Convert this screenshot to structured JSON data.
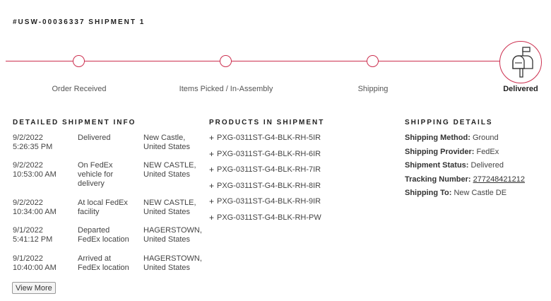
{
  "shipment": {
    "title": "#USW-00036337 SHIPMENT 1"
  },
  "tracker": {
    "accent_color": "#cc2f4f",
    "steps": [
      {
        "label": "Order Received"
      },
      {
        "label": "Items Picked / In-Assembly"
      },
      {
        "label": "Shipping"
      },
      {
        "label": "Delivered",
        "icon": "mailbox-icon",
        "active": true
      }
    ]
  },
  "detailed_info": {
    "heading": "DETAILED SHIPMENT INFO",
    "events": [
      {
        "date": "9/2/2022",
        "time": "5:26:35 PM",
        "status": "Delivered",
        "location_1": "New Castle,",
        "location_2": "United States"
      },
      {
        "date": "9/2/2022",
        "time": "10:53:00 AM",
        "status_1": "On FedEx",
        "status_2": "vehicle for",
        "status_3": "delivery",
        "location_1": "NEW CASTLE,",
        "location_2": "United States"
      },
      {
        "date": "9/2/2022",
        "time": "10:34:00 AM",
        "status_1": "At local FedEx",
        "status_2": "facility",
        "location_1": "NEW CASTLE,",
        "location_2": "United States"
      },
      {
        "date": "9/1/2022",
        "time": "5:41:12 PM",
        "status_1": "Departed",
        "status_2": "FedEx location",
        "location_1": "HAGERSTOWN,",
        "location_2": "United States"
      },
      {
        "date": "9/1/2022",
        "time": "10:40:00 AM",
        "status_1": "Arrived at",
        "status_2": "FedEx location",
        "location_1": "HAGERSTOWN,",
        "location_2": "United States"
      }
    ],
    "view_more_label": "View More"
  },
  "products": {
    "heading": "PRODUCTS IN SHIPMENT",
    "expand_symbol": "+",
    "items": [
      "PXG-0311ST-G4-BLK-RH-5IR",
      "PXG-0311ST-G4-BLK-RH-6IR",
      "PXG-0311ST-G4-BLK-RH-7IR",
      "PXG-0311ST-G4-BLK-RH-8IR",
      "PXG-0311ST-G4-BLK-RH-9IR",
      "PXG-0311ST-G4-BLK-RH-PW"
    ]
  },
  "shipping_details": {
    "heading": "SHIPPING DETAILS",
    "method_label": "Shipping Method:",
    "method_value": "Ground",
    "provider_label": "Shipping Provider:",
    "provider_value": "FedEx",
    "status_label": "Shipment Status:",
    "status_value": "Delivered",
    "tracking_label": "Tracking Number:",
    "tracking_value": "277248421212",
    "to_label": "Shipping To:",
    "to_value": "New Castle DE"
  }
}
